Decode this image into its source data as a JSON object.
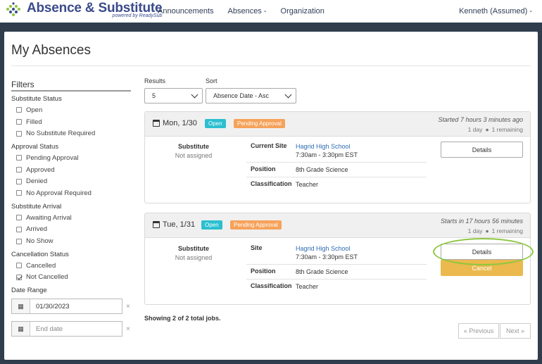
{
  "app": {
    "title": "Absence & Substitute",
    "subtitle": "powered by ReadySub"
  },
  "nav": {
    "items": [
      "Announcements",
      "Absences -",
      "Organization"
    ],
    "user": "Kenneth (Assumed) -"
  },
  "page": {
    "title": "My Absences"
  },
  "filters": {
    "title": "Filters",
    "groups": [
      {
        "label": "Substitute Status",
        "options": [
          {
            "label": "Open",
            "checked": false
          },
          {
            "label": "Filled",
            "checked": false
          },
          {
            "label": "No Substitute Required",
            "checked": false
          }
        ]
      },
      {
        "label": "Approval Status",
        "options": [
          {
            "label": "Pending Approval",
            "checked": false
          },
          {
            "label": "Approved",
            "checked": false
          },
          {
            "label": "Denied",
            "checked": false
          },
          {
            "label": "No Approval Required",
            "checked": false
          }
        ]
      },
      {
        "label": "Substitute Arrival",
        "options": [
          {
            "label": "Awaiting Arrival",
            "checked": false
          },
          {
            "label": "Arrived",
            "checked": false
          },
          {
            "label": "No Show",
            "checked": false
          }
        ]
      },
      {
        "label": "Cancellation Status",
        "options": [
          {
            "label": "Cancelled",
            "checked": false
          },
          {
            "label": "Not Cancelled",
            "checked": true
          }
        ]
      }
    ],
    "date_range": {
      "label": "Date Range",
      "start_value": "01/30/2023",
      "end_placeholder": "End date",
      "clear": "×"
    }
  },
  "controls": {
    "results_label": "Results",
    "results_value": "5",
    "sort_label": "Sort",
    "sort_value": "Absence Date - Asc"
  },
  "absences": [
    {
      "date": "Mon, 1/30",
      "badge_open": "Open",
      "badge_pending": "Pending Approval",
      "timing": "Started 7 hours 3 minutes ago",
      "meta_days": "1 day",
      "meta_remaining": "1 remaining",
      "substitute_label": "Substitute",
      "substitute_value": "Not assigned",
      "site_key": "Current Site",
      "site_name": "Hagrid High School",
      "site_time": "7:30am - 3:30pm EST",
      "position_key": "Position",
      "position_val": "8th Grade Science",
      "class_key": "Classification",
      "class_val": "Teacher",
      "details_label": "Details"
    },
    {
      "date": "Tue, 1/31",
      "badge_open": "Open",
      "badge_pending": "Pending Approval",
      "timing": "Starts in 17 hours 56 minutes",
      "meta_days": "1 day",
      "meta_remaining": "1 remaining",
      "substitute_label": "Substitute",
      "substitute_value": "Not assigned",
      "site_key": "Site",
      "site_name": "Hagrid High School",
      "site_time": "7:30am - 3:30pm EST",
      "position_key": "Position",
      "position_val": "8th Grade Science",
      "class_key": "Classification",
      "class_val": "Teacher",
      "details_label": "Details",
      "cancel_label": "Cancel"
    }
  ],
  "footer": {
    "showing": "Showing 2 of 2 total jobs.",
    "prev": "« Previous",
    "next": "Next »"
  },
  "colors": {
    "brand": "#3b4b8c",
    "badge_open": "#2bbfd0",
    "badge_pending": "#f6a25a",
    "cancel": "#ebb94d",
    "highlight": "#8dc63f",
    "link": "#2d6cb5"
  }
}
